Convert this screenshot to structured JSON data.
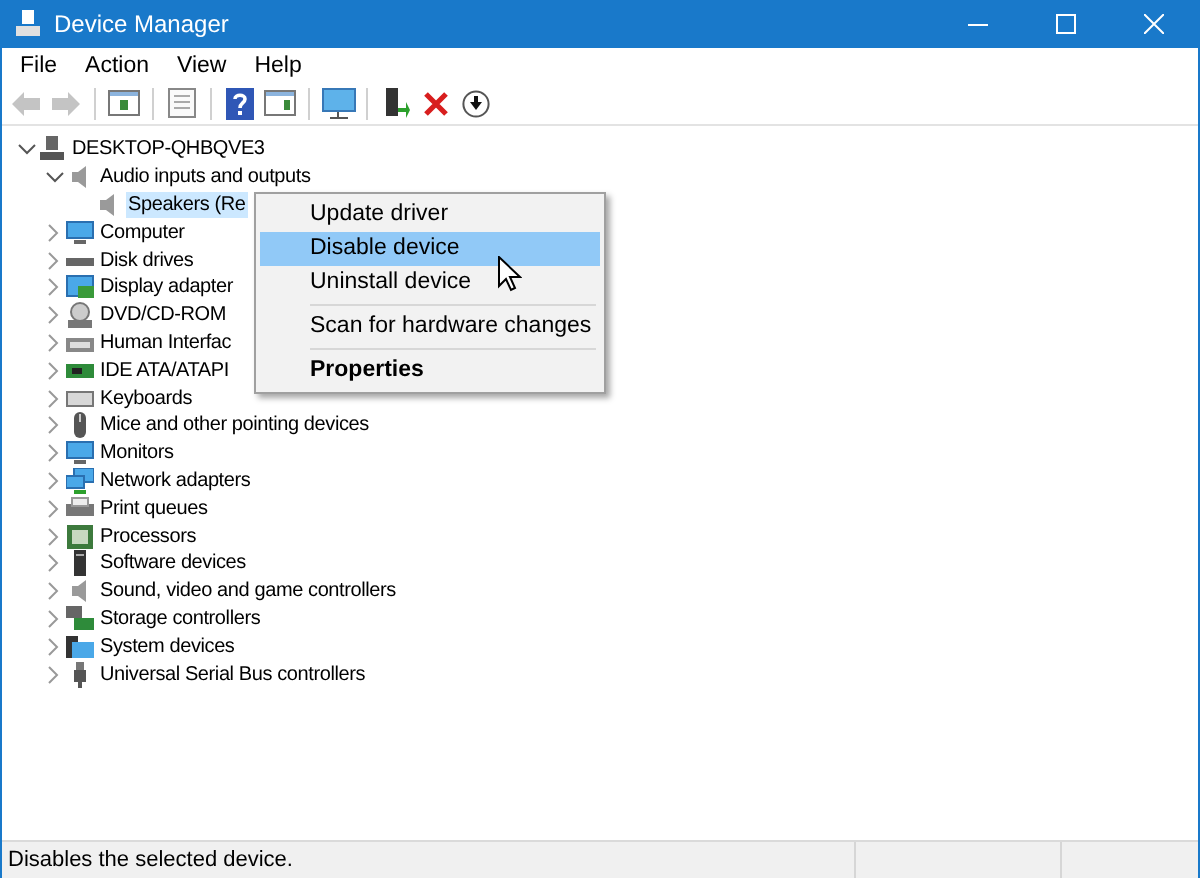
{
  "window": {
    "title": "Device Manager"
  },
  "menu_bar": [
    "File",
    "Action",
    "View",
    "Help"
  ],
  "toolbar": [
    {
      "kind": "back",
      "disabled": true
    },
    {
      "kind": "forward",
      "disabled": true
    },
    {
      "kind": "sep"
    },
    {
      "kind": "tree",
      "disabled": false
    },
    {
      "kind": "sep"
    },
    {
      "kind": "props",
      "disabled": false
    },
    {
      "kind": "sep"
    },
    {
      "kind": "help",
      "disabled": false
    },
    {
      "kind": "pane",
      "disabled": false
    },
    {
      "kind": "sep"
    },
    {
      "kind": "scan",
      "disabled": false
    },
    {
      "kind": "sep"
    },
    {
      "kind": "update",
      "disabled": false
    },
    {
      "kind": "uninstall",
      "disabled": false
    },
    {
      "kind": "disable",
      "disabled": false
    }
  ],
  "tree": [
    {
      "label": "DESKTOP-QHBQVE3",
      "kind": "computer",
      "expanded": true,
      "selected": false,
      "children": [
        {
          "label": "Audio inputs and outputs",
          "kind": "speaker",
          "expanded": true,
          "selected": false,
          "children": [
            {
              "label": "Speakers (Re",
              "kind": "speaker",
              "selected": true
            }
          ]
        },
        {
          "label": "Computer",
          "kind": "monitor",
          "expanded": false,
          "selected": false
        },
        {
          "label": "Disk drives",
          "kind": "disk",
          "expanded": false,
          "selected": false
        },
        {
          "label": "Display adapter",
          "kind": "display",
          "expanded": false,
          "selected": false
        },
        {
          "label": "DVD/CD-ROM",
          "kind": "dvd",
          "expanded": false,
          "selected": false
        },
        {
          "label": "Human Interfac",
          "kind": "hid",
          "expanded": false,
          "selected": false
        },
        {
          "label": "IDE ATA/ATAPI",
          "kind": "card",
          "expanded": false,
          "selected": false
        },
        {
          "label": "Keyboards",
          "kind": "keyboard",
          "expanded": false,
          "selected": false
        },
        {
          "label": "Mice and other pointing devices",
          "kind": "mouse",
          "expanded": false,
          "selected": false
        },
        {
          "label": "Monitors",
          "kind": "monitor",
          "expanded": false,
          "selected": false
        },
        {
          "label": "Network adapters",
          "kind": "network",
          "expanded": false,
          "selected": false
        },
        {
          "label": "Print queues",
          "kind": "printer",
          "expanded": false,
          "selected": false
        },
        {
          "label": "Processors",
          "kind": "chip",
          "expanded": false,
          "selected": false
        },
        {
          "label": "Software devices",
          "kind": "tower",
          "expanded": false,
          "selected": false
        },
        {
          "label": "Sound, video and game controllers",
          "kind": "speaker",
          "expanded": false,
          "selected": false
        },
        {
          "label": "Storage controllers",
          "kind": "storage",
          "expanded": false,
          "selected": false
        },
        {
          "label": "System devices",
          "kind": "folder",
          "expanded": false,
          "selected": false
        },
        {
          "label": "Universal Serial Bus controllers",
          "kind": "usb",
          "expanded": false,
          "selected": false
        }
      ]
    }
  ],
  "context_menu": [
    {
      "kind": "item",
      "label": "Update driver",
      "selected": false,
      "default": false
    },
    {
      "kind": "item",
      "label": "Disable device",
      "selected": true,
      "default": false
    },
    {
      "kind": "item",
      "label": "Uninstall device",
      "selected": false,
      "default": false
    },
    {
      "kind": "sep"
    },
    {
      "kind": "item",
      "label": "Scan for hardware changes",
      "selected": false,
      "default": false
    },
    {
      "kind": "sep"
    },
    {
      "kind": "item",
      "label": "Properties",
      "selected": false,
      "default": true
    }
  ],
  "status_bar": "Disables the selected device."
}
